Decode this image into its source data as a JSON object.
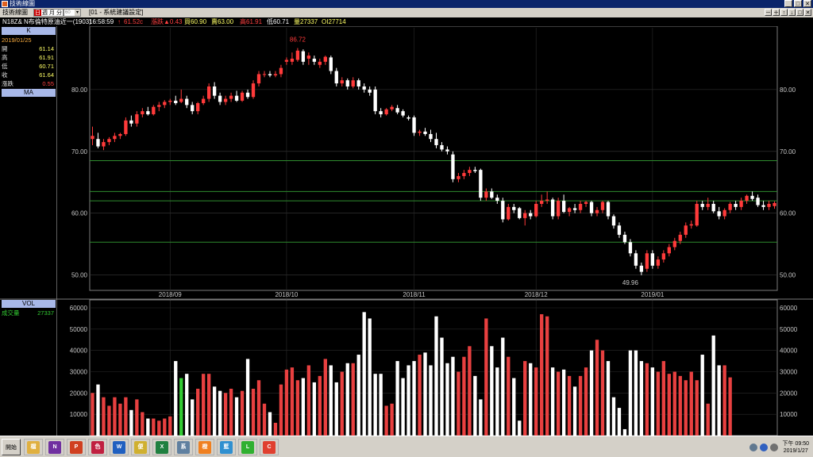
{
  "window": {
    "title": "技術線圖"
  },
  "toolbar": {
    "label": "技術線圖",
    "periods": [
      "日",
      "週",
      "月",
      "分"
    ],
    "selected_period": "日",
    "combo_value": "60",
    "tab_label": "[01 - 系統建議設定]",
    "controls": [
      "－",
      "＋",
      "↑",
      "↓",
      "□",
      "✕"
    ]
  },
  "quote": {
    "symbol": "N18Z&",
    "name": "N布倫特原油近一(1903)",
    "time": "16:58:59",
    "arrow": "↑",
    "last": "61.52c",
    "change_label": "漲跌▲0.43",
    "bid": "買60.90",
    "ask": "賣63.00",
    "high": "高61.91",
    "low": "低60.71",
    "volume": "量27337",
    "oi": "OI27714"
  },
  "panel": {
    "k_header": "K",
    "date": "2019/01/25",
    "rows": [
      {
        "label": "開",
        "value": "61.14"
      },
      {
        "label": "高",
        "value": "61.91"
      },
      {
        "label": "低",
        "value": "60.71"
      },
      {
        "label": "收",
        "value": "61.64"
      },
      {
        "label": "漲跌",
        "value": "0.55"
      }
    ],
    "ma_header": "MA",
    "vol_header": "VOL",
    "vol_label": "成交量",
    "vol_value": "27337"
  },
  "colors": {
    "up": "#ff3a3a",
    "down": "#ffffff",
    "vol_up": "#e84040",
    "vol_down": "#ffffff",
    "highlight": "#33cc33",
    "hline": "#2e8b2e",
    "axis_text": "#c8c8c8"
  },
  "chart_data": [
    {
      "type": "candlestick",
      "title": "",
      "price_axis_ticks": [
        "50.00",
        "60.00",
        "70.00",
        "80.00"
      ],
      "price_ticks": [
        50,
        60,
        70,
        80
      ],
      "ylim": [
        47.5,
        90
      ],
      "x_labels": [
        {
          "label": "2018/09",
          "index": 14
        },
        {
          "label": "2018/10",
          "index": 35
        },
        {
          "label": "2018/11",
          "index": 58
        },
        {
          "label": "2018/12",
          "index": 80
        },
        {
          "label": "2019/01",
          "index": 101
        }
      ],
      "annotations": [
        {
          "text": "86.72",
          "index": 37,
          "value": 86.72,
          "position": "above"
        },
        {
          "text": "49.96",
          "index": 97,
          "value": 49.96,
          "position": "below"
        }
      ],
      "horizontal_lines": [
        68.5,
        63.5,
        62.0,
        55.3
      ],
      "candles": [
        {
          "o": 72.0,
          "h": 74.0,
          "l": 71.0,
          "c": 72.5
        },
        {
          "o": 72.0,
          "h": 73.0,
          "l": 70.5,
          "c": 70.8
        },
        {
          "o": 70.8,
          "h": 72.0,
          "l": 70.2,
          "c": 71.5
        },
        {
          "o": 71.5,
          "h": 72.3,
          "l": 71.0,
          "c": 72.0
        },
        {
          "o": 72.0,
          "h": 73.0,
          "l": 71.5,
          "c": 72.5
        },
        {
          "o": 72.5,
          "h": 73.0,
          "l": 72.0,
          "c": 72.8
        },
        {
          "o": 72.8,
          "h": 75.5,
          "l": 72.5,
          "c": 75.0
        },
        {
          "o": 75.0,
          "h": 75.8,
          "l": 74.0,
          "c": 74.5
        },
        {
          "o": 74.5,
          "h": 76.5,
          "l": 74.0,
          "c": 76.0
        },
        {
          "o": 76.0,
          "h": 77.0,
          "l": 75.5,
          "c": 76.5
        },
        {
          "o": 76.5,
          "h": 77.2,
          "l": 75.8,
          "c": 76.0
        },
        {
          "o": 76.0,
          "h": 77.5,
          "l": 75.8,
          "c": 77.2
        },
        {
          "o": 77.2,
          "h": 78.0,
          "l": 76.5,
          "c": 77.5
        },
        {
          "o": 77.5,
          "h": 78.3,
          "l": 77.0,
          "c": 78.0
        },
        {
          "o": 78.0,
          "h": 78.5,
          "l": 77.5,
          "c": 78.2
        },
        {
          "o": 78.2,
          "h": 79.0,
          "l": 77.5,
          "c": 77.8
        },
        {
          "o": 78.0,
          "h": 80.0,
          "l": 77.8,
          "c": 78.5
        },
        {
          "o": 78.5,
          "h": 79.0,
          "l": 77.0,
          "c": 77.5
        },
        {
          "o": 77.5,
          "h": 78.0,
          "l": 76.0,
          "c": 76.5
        },
        {
          "o": 76.5,
          "h": 78.0,
          "l": 76.0,
          "c": 77.8
        },
        {
          "o": 77.8,
          "h": 79.0,
          "l": 77.5,
          "c": 78.5
        },
        {
          "o": 78.5,
          "h": 81.0,
          "l": 78.0,
          "c": 80.5
        },
        {
          "o": 80.5,
          "h": 81.2,
          "l": 78.5,
          "c": 79.0
        },
        {
          "o": 79.0,
          "h": 79.5,
          "l": 77.5,
          "c": 78.0
        },
        {
          "o": 78.0,
          "h": 79.0,
          "l": 77.5,
          "c": 78.5
        },
        {
          "o": 78.5,
          "h": 79.5,
          "l": 78.0,
          "c": 79.0
        },
        {
          "o": 79.0,
          "h": 79.8,
          "l": 78.0,
          "c": 78.2
        },
        {
          "o": 78.2,
          "h": 79.8,
          "l": 78.0,
          "c": 79.5
        },
        {
          "o": 79.5,
          "h": 80.0,
          "l": 78.5,
          "c": 78.8
        },
        {
          "o": 78.8,
          "h": 81.5,
          "l": 78.5,
          "c": 81.0
        },
        {
          "o": 81.0,
          "h": 83.0,
          "l": 80.5,
          "c": 82.5
        },
        {
          "o": 82.5,
          "h": 83.0,
          "l": 82.0,
          "c": 82.5
        },
        {
          "o": 82.5,
          "h": 83.0,
          "l": 82.0,
          "c": 82.3
        },
        {
          "o": 82.3,
          "h": 83.0,
          "l": 82.0,
          "c": 82.5
        },
        {
          "o": 82.5,
          "h": 84.0,
          "l": 82.0,
          "c": 83.5
        },
        {
          "o": 84.5,
          "h": 85.2,
          "l": 84.0,
          "c": 84.8
        },
        {
          "o": 84.5,
          "h": 86.0,
          "l": 84.0,
          "c": 85.0
        },
        {
          "o": 84.8,
          "h": 86.72,
          "l": 84.5,
          "c": 86.3
        },
        {
          "o": 86.2,
          "h": 86.5,
          "l": 84.0,
          "c": 84.5
        },
        {
          "o": 85.0,
          "h": 86.0,
          "l": 84.0,
          "c": 85.5
        },
        {
          "o": 85.0,
          "h": 85.5,
          "l": 84.0,
          "c": 84.5
        },
        {
          "o": 84.0,
          "h": 85.0,
          "l": 83.5,
          "c": 84.5
        },
        {
          "o": 84.5,
          "h": 85.5,
          "l": 84.0,
          "c": 85.3
        },
        {
          "o": 85.2,
          "h": 85.5,
          "l": 82.5,
          "c": 83.0
        },
        {
          "o": 83.0,
          "h": 83.5,
          "l": 80.5,
          "c": 81.0
        },
        {
          "o": 81.0,
          "h": 82.0,
          "l": 80.5,
          "c": 81.5
        },
        {
          "o": 81.5,
          "h": 81.8,
          "l": 80.0,
          "c": 80.5
        },
        {
          "o": 80.5,
          "h": 82.0,
          "l": 80.2,
          "c": 81.5
        },
        {
          "o": 81.5,
          "h": 81.8,
          "l": 80.0,
          "c": 80.5
        },
        {
          "o": 80.5,
          "h": 81.0,
          "l": 79.5,
          "c": 80.0
        },
        {
          "o": 80.0,
          "h": 80.5,
          "l": 79.0,
          "c": 79.5
        },
        {
          "o": 80.0,
          "h": 80.5,
          "l": 76.0,
          "c": 76.5
        },
        {
          "o": 76.5,
          "h": 77.0,
          "l": 75.5,
          "c": 76.0
        },
        {
          "o": 76.0,
          "h": 77.0,
          "l": 75.8,
          "c": 76.8
        },
        {
          "o": 76.8,
          "h": 77.5,
          "l": 76.5,
          "c": 77.2
        },
        {
          "o": 77.0,
          "h": 77.5,
          "l": 76.0,
          "c": 76.3
        },
        {
          "o": 76.5,
          "h": 76.8,
          "l": 75.5,
          "c": 75.8
        },
        {
          "o": 75.5,
          "h": 75.8,
          "l": 75.0,
          "c": 75.3
        },
        {
          "o": 75.5,
          "h": 75.8,
          "l": 72.5,
          "c": 73.0
        },
        {
          "o": 73.0,
          "h": 73.5,
          "l": 72.5,
          "c": 73.2
        },
        {
          "o": 73.2,
          "h": 73.8,
          "l": 72.5,
          "c": 72.8
        },
        {
          "o": 72.8,
          "h": 73.5,
          "l": 71.5,
          "c": 72.0
        },
        {
          "o": 72.0,
          "h": 73.0,
          "l": 70.5,
          "c": 71.0
        },
        {
          "o": 71.0,
          "h": 71.5,
          "l": 70.0,
          "c": 70.3
        },
        {
          "o": 70.3,
          "h": 70.8,
          "l": 69.5,
          "c": 70.0
        },
        {
          "o": 69.5,
          "h": 70.0,
          "l": 65.0,
          "c": 65.5
        },
        {
          "o": 65.5,
          "h": 66.5,
          "l": 65.0,
          "c": 66.0
        },
        {
          "o": 66.0,
          "h": 67.0,
          "l": 65.5,
          "c": 66.5
        },
        {
          "o": 66.5,
          "h": 67.5,
          "l": 66.0,
          "c": 67.0
        },
        {
          "o": 67.0,
          "h": 67.5,
          "l": 66.5,
          "c": 66.8
        },
        {
          "o": 67.0,
          "h": 67.2,
          "l": 62.0,
          "c": 62.5
        },
        {
          "o": 62.5,
          "h": 64.0,
          "l": 62.0,
          "c": 63.5
        },
        {
          "o": 63.5,
          "h": 64.0,
          "l": 62.3,
          "c": 62.5
        },
        {
          "o": 62.5,
          "h": 63.0,
          "l": 61.5,
          "c": 62.0
        },
        {
          "o": 62.0,
          "h": 62.5,
          "l": 58.5,
          "c": 59.0
        },
        {
          "o": 59.0,
          "h": 61.5,
          "l": 58.8,
          "c": 61.0
        },
        {
          "o": 61.0,
          "h": 61.5,
          "l": 60.0,
          "c": 60.5
        },
        {
          "o": 60.8,
          "h": 61.0,
          "l": 59.0,
          "c": 59.2
        },
        {
          "o": 59.2,
          "h": 60.5,
          "l": 58.0,
          "c": 60.0
        },
        {
          "o": 60.0,
          "h": 60.5,
          "l": 59.0,
          "c": 59.5
        },
        {
          "o": 59.5,
          "h": 62.0,
          "l": 59.3,
          "c": 61.5
        },
        {
          "o": 61.5,
          "h": 63.0,
          "l": 61.0,
          "c": 62.0
        },
        {
          "o": 62.0,
          "h": 63.5,
          "l": 61.5,
          "c": 62.2
        },
        {
          "o": 62.2,
          "h": 62.5,
          "l": 59.0,
          "c": 59.5
        },
        {
          "o": 59.5,
          "h": 62.5,
          "l": 59.0,
          "c": 62.0
        },
        {
          "o": 62.0,
          "h": 63.0,
          "l": 60.0,
          "c": 60.2
        },
        {
          "o": 60.2,
          "h": 61.0,
          "l": 59.5,
          "c": 60.8
        },
        {
          "o": 60.8,
          "h": 61.5,
          "l": 60.0,
          "c": 60.5
        },
        {
          "o": 60.5,
          "h": 62.0,
          "l": 60.0,
          "c": 61.5
        },
        {
          "o": 61.5,
          "h": 62.0,
          "l": 61.0,
          "c": 61.8
        },
        {
          "o": 61.8,
          "h": 62.0,
          "l": 59.5,
          "c": 60.0
        },
        {
          "o": 60.0,
          "h": 61.0,
          "l": 59.5,
          "c": 60.5
        },
        {
          "o": 60.5,
          "h": 62.0,
          "l": 60.0,
          "c": 61.8
        },
        {
          "o": 61.8,
          "h": 62.0,
          "l": 59.0,
          "c": 59.5
        },
        {
          "o": 59.5,
          "h": 59.8,
          "l": 57.5,
          "c": 58.0
        },
        {
          "o": 58.0,
          "h": 58.5,
          "l": 56.0,
          "c": 56.5
        },
        {
          "o": 56.5,
          "h": 57.0,
          "l": 55.0,
          "c": 55.3
        },
        {
          "o": 55.3,
          "h": 55.8,
          "l": 53.0,
          "c": 53.5
        },
        {
          "o": 53.5,
          "h": 54.0,
          "l": 51.0,
          "c": 51.5
        },
        {
          "o": 51.5,
          "h": 52.0,
          "l": 49.96,
          "c": 50.5
        },
        {
          "o": 51.0,
          "h": 54.0,
          "l": 50.5,
          "c": 53.5
        },
        {
          "o": 53.5,
          "h": 54.0,
          "l": 51.0,
          "c": 51.5
        },
        {
          "o": 51.5,
          "h": 53.0,
          "l": 51.0,
          "c": 52.5
        },
        {
          "o": 52.5,
          "h": 54.0,
          "l": 52.0,
          "c": 53.5
        },
        {
          "o": 53.5,
          "h": 55.0,
          "l": 53.0,
          "c": 54.5
        },
        {
          "o": 54.5,
          "h": 56.0,
          "l": 54.0,
          "c": 55.5
        },
        {
          "o": 55.5,
          "h": 57.0,
          "l": 55.0,
          "c": 56.5
        },
        {
          "o": 56.5,
          "h": 58.5,
          "l": 56.0,
          "c": 58.0
        },
        {
          "o": 58.0,
          "h": 58.8,
          "l": 57.5,
          "c": 58.2
        },
        {
          "o": 58.0,
          "h": 62.0,
          "l": 57.8,
          "c": 61.5
        },
        {
          "o": 61.5,
          "h": 62.0,
          "l": 60.5,
          "c": 61.0
        },
        {
          "o": 61.0,
          "h": 62.5,
          "l": 60.5,
          "c": 61.5
        },
        {
          "o": 61.5,
          "h": 62.0,
          "l": 60.0,
          "c": 60.3
        },
        {
          "o": 60.3,
          "h": 61.0,
          "l": 59.0,
          "c": 59.5
        },
        {
          "o": 59.5,
          "h": 60.8,
          "l": 59.0,
          "c": 60.5
        },
        {
          "o": 60.5,
          "h": 61.8,
          "l": 60.0,
          "c": 61.5
        },
        {
          "o": 61.5,
          "h": 62.0,
          "l": 60.5,
          "c": 61.0
        },
        {
          "o": 61.0,
          "h": 62.5,
          "l": 60.5,
          "c": 62.0
        },
        {
          "o": 62.0,
          "h": 63.0,
          "l": 61.5,
          "c": 62.8
        },
        {
          "o": 62.8,
          "h": 63.5,
          "l": 62.0,
          "c": 62.3
        },
        {
          "o": 62.5,
          "h": 63.0,
          "l": 61.0,
          "c": 61.3
        },
        {
          "o": 61.3,
          "h": 62.0,
          "l": 60.5,
          "c": 61.0
        },
        {
          "o": 61.0,
          "h": 62.0,
          "l": 60.5,
          "c": 61.5
        },
        {
          "o": 61.14,
          "h": 61.91,
          "l": 60.71,
          "c": 61.64
        }
      ]
    },
    {
      "type": "bar",
      "title": "VOL",
      "axis_ticks": [
        "10000",
        "20000",
        "30000",
        "40000",
        "50000",
        "60000"
      ],
      "tick_values": [
        10000,
        20000,
        30000,
        40000,
        50000,
        60000
      ],
      "ylim": [
        0,
        60000
      ],
      "highlight_index": 16,
      "values": [
        20000,
        24000,
        18000,
        14000,
        18000,
        15000,
        18000,
        12000,
        17000,
        11000,
        8000,
        8000,
        7000,
        8000,
        9000,
        35000,
        27000,
        29000,
        17000,
        22000,
        29000,
        29000,
        23000,
        21000,
        20000,
        22000,
        18000,
        21000,
        36000,
        22000,
        26000,
        15000,
        11000,
        6000,
        24000,
        31000,
        32000,
        26000,
        27000,
        33000,
        25000,
        28000,
        36000,
        33000,
        25000,
        30000,
        34000,
        34000,
        38000,
        58000,
        55000,
        29000,
        29000,
        14000,
        15000,
        35000,
        27000,
        33000,
        35000,
        38000,
        39000,
        33000,
        56000,
        46000,
        34000,
        37000,
        30000,
        37000,
        42000,
        28000,
        17000,
        55000,
        42000,
        32000,
        46000,
        37000,
        27000,
        7000,
        35000,
        34000,
        32000,
        57000,
        56000,
        32000,
        30000,
        31000,
        28000,
        23000,
        28000,
        32000,
        40000,
        45000,
        40000,
        35000,
        18000,
        13000,
        3000,
        40000,
        40000,
        35000,
        34000,
        32000,
        30000,
        35000,
        29000,
        30000,
        28000,
        26000,
        30000,
        26000,
        38000,
        15000,
        47000,
        33000,
        33000,
        27337
      ]
    }
  ],
  "taskbar": {
    "start_label": "開始",
    "apps": [
      "檔案總管",
      "N",
      "P",
      "色彩",
      "W",
      "便條",
      "X",
      "系統",
      "橙",
      "藍",
      "Line",
      "Chrome"
    ],
    "clock_time": "下午 09:50",
    "clock_date": "2019/1/27"
  }
}
